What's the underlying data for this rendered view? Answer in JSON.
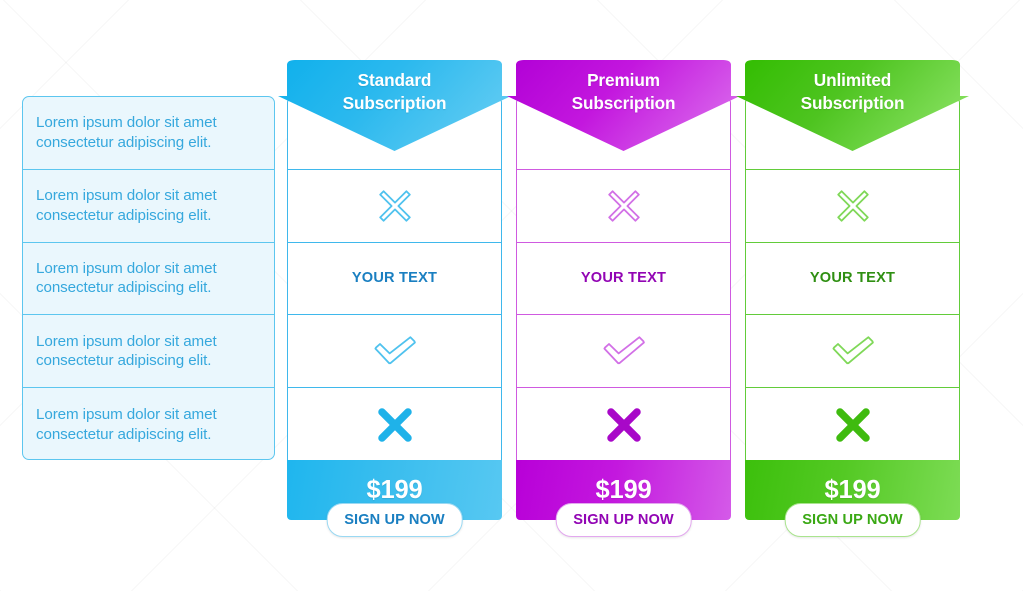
{
  "theme": {
    "blue": {
      "solid": "#23b4ea",
      "dark": "#1a7fc1",
      "light": "#57c8f2",
      "line": "#3fb8ec",
      "pale": "#7fd2f2"
    },
    "magenta": {
      "solid": "#c213dd",
      "dark": "#9205b4",
      "light": "#d45ae8",
      "line": "#cf5ae0",
      "pale": "#e08cf0"
    },
    "green": {
      "solid": "#4ec420",
      "dark": "#2f8f12",
      "light": "#7ddc55",
      "line": "#62cc3a",
      "pale": "#97e07a"
    }
  },
  "features": {
    "rows": [
      "Lorem ipsum dolor sit amet consectetur adipiscing elit.",
      "Lorem ipsum dolor sit amet consectetur adipiscing elit.",
      "Lorem ipsum dolor sit amet consectetur adipiscing elit.",
      "Lorem ipsum dolor sit amet consectetur adipiscing elit.",
      "Lorem ipsum dolor sit amet consectetur adipiscing elit."
    ]
  },
  "plans": [
    {
      "id": "standard",
      "title_line1": "Standard",
      "title_line2": "Subscription",
      "accent": "#23b4ea",
      "cells": [
        {
          "kind": "check-solid-icon",
          "text": ""
        },
        {
          "kind": "cross-outline-icon",
          "text": ""
        },
        {
          "kind": "text",
          "text": "YOUR TEXT"
        },
        {
          "kind": "check-outline-icon",
          "text": ""
        },
        {
          "kind": "cross-solid-icon",
          "text": ""
        }
      ],
      "price": "$199",
      "cta": "SIGN UP NOW"
    },
    {
      "id": "premium",
      "title_line1": "Premium",
      "title_line2": "Subscription",
      "accent": "#c213dd",
      "cells": [
        {
          "kind": "check-solid-icon",
          "text": ""
        },
        {
          "kind": "cross-outline-icon",
          "text": ""
        },
        {
          "kind": "text",
          "text": "YOUR TEXT"
        },
        {
          "kind": "check-outline-icon",
          "text": ""
        },
        {
          "kind": "cross-solid-icon",
          "text": ""
        }
      ],
      "price": "$199",
      "cta": "SIGN UP NOW"
    },
    {
      "id": "unlimited",
      "title_line1": "Unlimited",
      "title_line2": "Subscription",
      "accent": "#4ec420",
      "cells": [
        {
          "kind": "check-solid-icon",
          "text": ""
        },
        {
          "kind": "cross-outline-icon",
          "text": ""
        },
        {
          "kind": "text",
          "text": "YOUR TEXT"
        },
        {
          "kind": "check-outline-icon",
          "text": ""
        },
        {
          "kind": "cross-solid-icon",
          "text": ""
        }
      ],
      "price": "$199",
      "cta": "SIGN UP NOW"
    }
  ]
}
